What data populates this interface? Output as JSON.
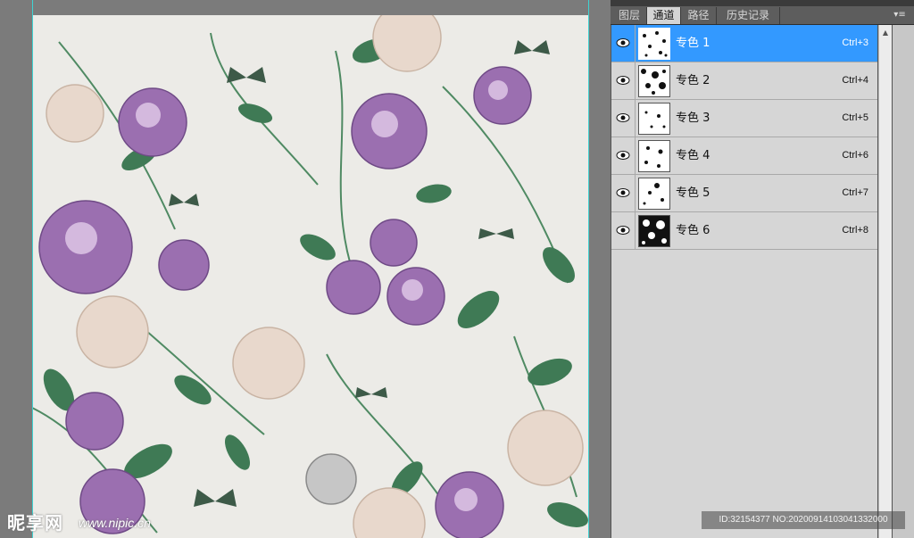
{
  "panel": {
    "tabs": [
      {
        "label": "图层",
        "active": false
      },
      {
        "label": "通道",
        "active": true
      },
      {
        "label": "路径",
        "active": false
      },
      {
        "label": "历史记录",
        "active": false
      }
    ],
    "menu_icon": "panel-menu-icon",
    "channels": [
      {
        "name": "专色 1",
        "shortcut": "Ctrl+3",
        "selected": true,
        "visible": true
      },
      {
        "name": "专色 2",
        "shortcut": "Ctrl+4",
        "selected": false,
        "visible": true
      },
      {
        "name": "专色 3",
        "shortcut": "Ctrl+5",
        "selected": false,
        "visible": true
      },
      {
        "name": "专色 4",
        "shortcut": "Ctrl+6",
        "selected": false,
        "visible": true
      },
      {
        "name": "专色 5",
        "shortcut": "Ctrl+7",
        "selected": false,
        "visible": true
      },
      {
        "name": "专色 6",
        "shortcut": "Ctrl+8",
        "selected": false,
        "visible": true
      }
    ]
  },
  "canvas": {
    "description_icon": "floral-pattern-artwork",
    "colors": {
      "background": "#ecebe7",
      "purple": "#9b6fb0",
      "cream": "#e8d8cc",
      "leaf": "#3f7a55",
      "guide": "#3fd3d3"
    }
  },
  "watermark": {
    "logo": "昵享网",
    "url": "www.nipic.cn",
    "id_text": "ID:32154377 NO:20200914103041332000"
  },
  "colors": {
    "selection": "#3399ff",
    "panel_bg": "#d6d6d6"
  }
}
